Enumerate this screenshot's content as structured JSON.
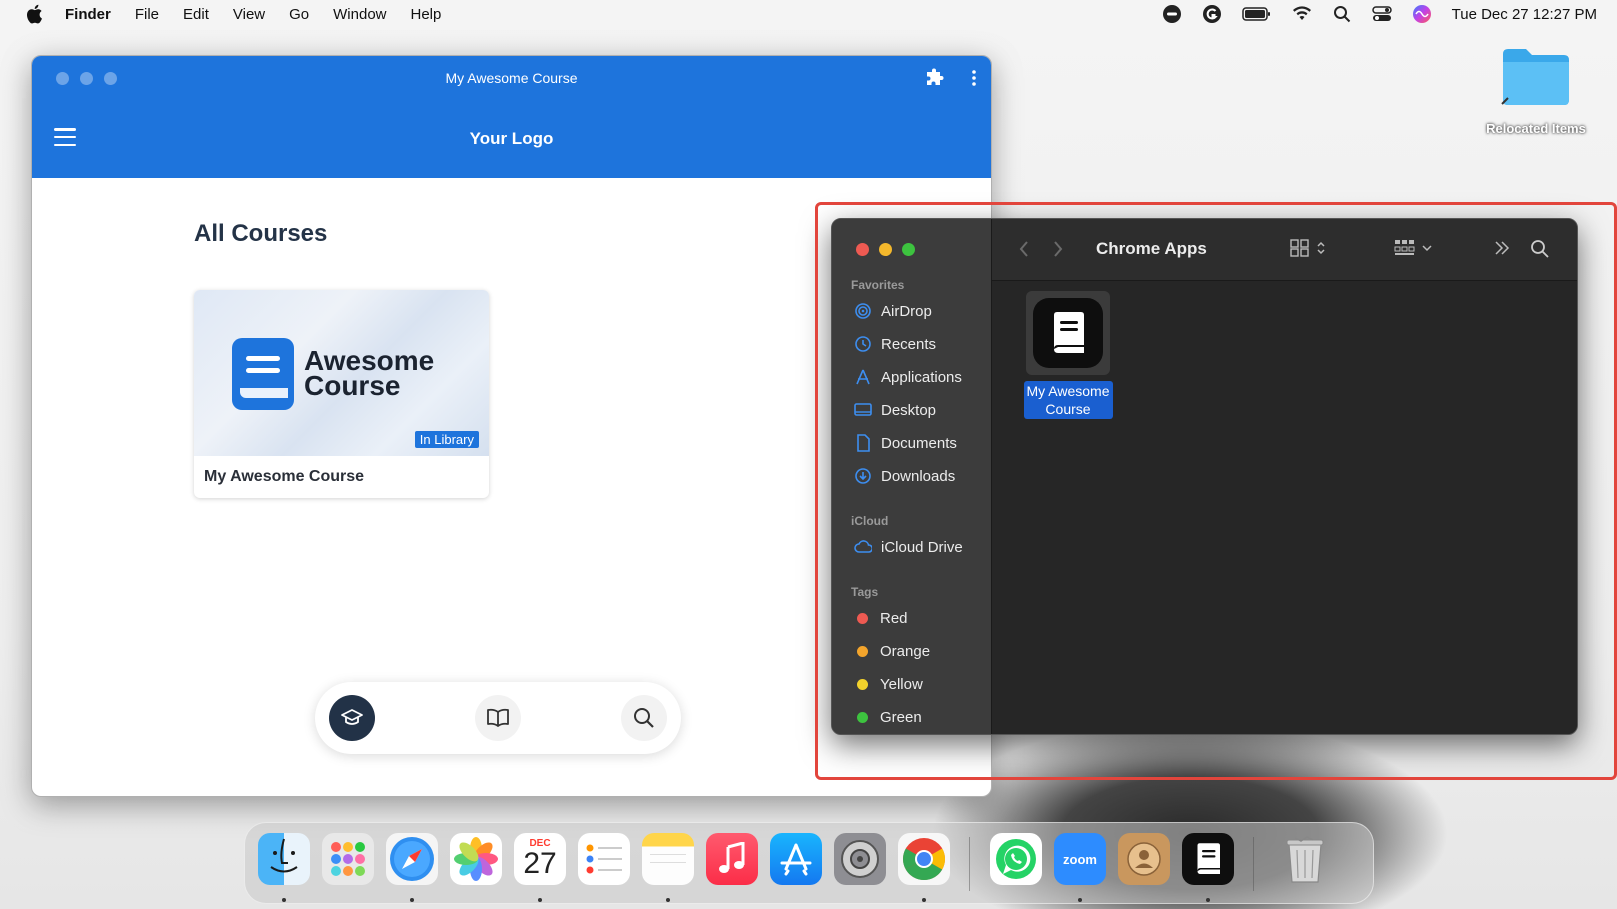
{
  "menubar": {
    "app": "Finder",
    "menus": [
      "File",
      "Edit",
      "View",
      "Go",
      "Window",
      "Help"
    ],
    "clock": "Tue Dec 27  12:27 PM"
  },
  "desktop": {
    "folder_label": "Relocated Items"
  },
  "course_app": {
    "window_title": "My Awesome Course",
    "logo": "Your Logo",
    "section_title": "All Courses",
    "card": {
      "thumb_line1": "Awesome",
      "thumb_line2": "Course",
      "badge": "In Library",
      "name": "My Awesome Course"
    }
  },
  "finder": {
    "title": "Chrome Apps",
    "favorites_header": "Favorites",
    "favorites": [
      "AirDrop",
      "Recents",
      "Applications",
      "Desktop",
      "Documents",
      "Downloads"
    ],
    "icloud_header": "iCloud",
    "icloud": [
      "iCloud Drive"
    ],
    "tags_header": "Tags",
    "tags": [
      {
        "label": "Red",
        "color": "#ee5a52"
      },
      {
        "label": "Orange",
        "color": "#f4a52c"
      },
      {
        "label": "Yellow",
        "color": "#f2d22c"
      },
      {
        "label": "Green",
        "color": "#3dc33f"
      }
    ],
    "file_line1": "My Awesome",
    "file_line2": "Course"
  },
  "dock": {
    "calendar_month": "DEC",
    "calendar_day": "27",
    "zoom_label": "zoom"
  },
  "colors": {
    "accent": "#1e74dc",
    "highlight": "#e2453c"
  }
}
